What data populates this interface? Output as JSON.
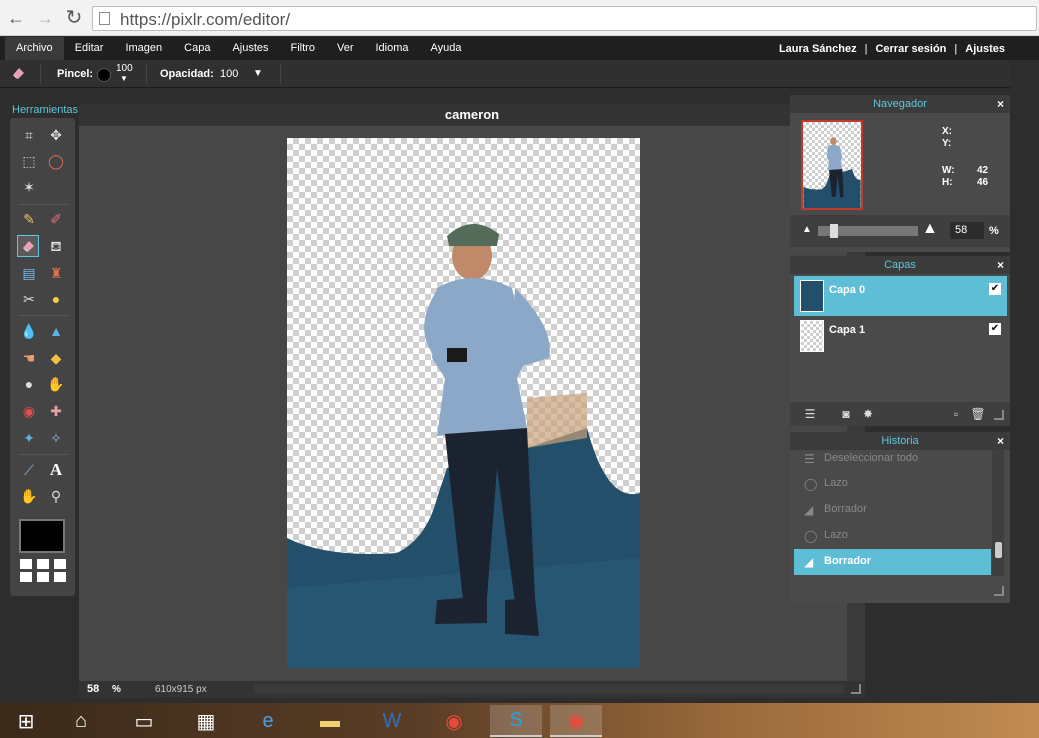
{
  "browser": {
    "url": "https://pixlr.com/editor/"
  },
  "menu": {
    "items": [
      "Archivo",
      "Editar",
      "Imagen",
      "Capa",
      "Ajustes",
      "Filtro",
      "Ver",
      "Idioma",
      "Ayuda"
    ],
    "active": "Archivo",
    "user": "Laura Sánchez",
    "logout": "Cerrar sesión",
    "settings": "Ajustes",
    "separator": "|"
  },
  "options": {
    "brush_label": "Pincel:",
    "brush_size": "100",
    "opacity_label": "Opacidad:",
    "opacity_value": "100"
  },
  "tools": {
    "title": "Herramientas",
    "selected": "eraser",
    "primary_color": "#000000"
  },
  "canvas": {
    "title": "cameron",
    "zoom": "58",
    "zoom_unit": "%",
    "doc_size": "610x915 px"
  },
  "navigator": {
    "title": "Navegador",
    "close": "×",
    "x_label": "X:",
    "y_label": "Y:",
    "w_label": "W:",
    "h_label": "H:",
    "w_value": "42",
    "h_value": "46",
    "zoom": "58",
    "zoom_unit": "%"
  },
  "layers": {
    "title": "Capas",
    "close": "×",
    "items": [
      {
        "name": "Capa 0",
        "visible": true,
        "active": true
      },
      {
        "name": "Capa 1",
        "visible": true,
        "active": false
      }
    ]
  },
  "history": {
    "title": "Historia",
    "close": "×",
    "items": [
      {
        "label": "Deseleccionar todo",
        "icon": "deselect-icon",
        "active": false
      },
      {
        "label": "Lazo",
        "icon": "lasso-icon",
        "active": false
      },
      {
        "label": "Borrador",
        "icon": "eraser-icon",
        "active": false
      },
      {
        "label": "Lazo",
        "icon": "lasso-icon",
        "active": false
      },
      {
        "label": "Borrador",
        "icon": "eraser-icon",
        "active": true
      }
    ]
  },
  "colors": {
    "accent": "#5dbed6",
    "menubar": "#1f1f1f",
    "panel": "#4a4a4a"
  }
}
